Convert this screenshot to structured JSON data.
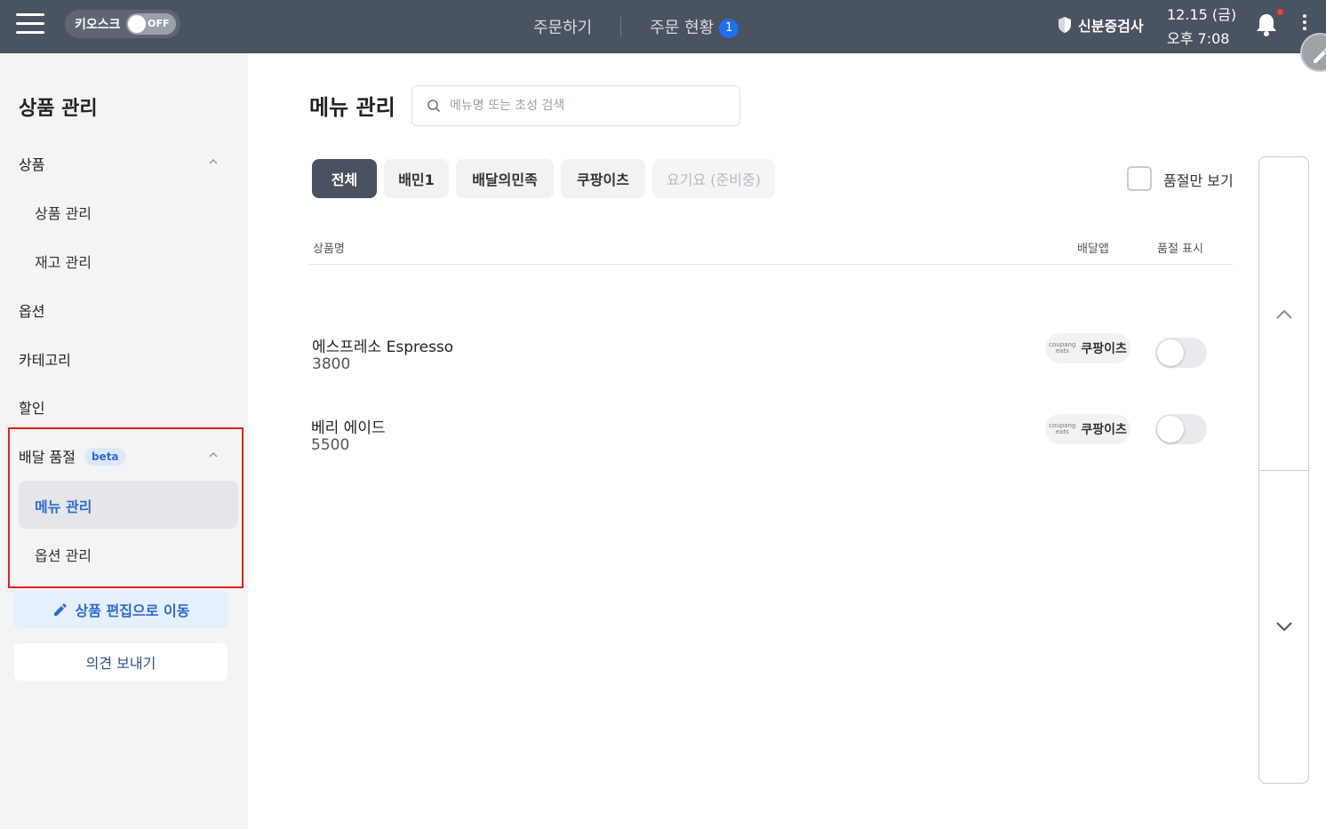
{
  "topbar": {
    "kiosk_label": "키오스크",
    "kiosk_toggle_state": "OFF",
    "nav": {
      "order": "주문하기",
      "status": "주문 현황",
      "status_badge": "1"
    },
    "id_check": "신분증검사",
    "date": "12.15 (금)",
    "time": "오후 7:08"
  },
  "sidebar": {
    "title": "상품 관리",
    "sections": {
      "product": "상품",
      "product_manage": "상품 관리",
      "stock_manage": "재고 관리",
      "option": "옵션",
      "category": "카테고리",
      "discount": "할인",
      "delivery_soldout": "배달 품절",
      "beta": "beta",
      "menu_manage": "메뉴 관리",
      "option_manage": "옵션 관리"
    },
    "edit_button": "상품 편집으로 이동",
    "feedback_button": "의견 보내기"
  },
  "main": {
    "title": "메뉴 관리",
    "search_placeholder": "메뉴명 또는 초성 검색",
    "filters": [
      "전체",
      "배민1",
      "배달의민족",
      "쿠팡이츠",
      "요기요 (준비중)"
    ],
    "active_filter": "전체",
    "soldout_only_label": "품절만 보기",
    "columns": {
      "name": "상품명",
      "app": "배달앱",
      "soldout": "품절 표시"
    },
    "rows": [
      {
        "name": "에스프레소 Espresso",
        "price": "3800",
        "app": "쿠팡이츠",
        "soldout": false
      },
      {
        "name": "베리 에이드",
        "price": "5500",
        "app": "쿠팡이츠",
        "soldout": false
      }
    ]
  },
  "icons": {
    "menu": "hamburger-icon",
    "shield": "shield-icon",
    "bell": "bell-icon",
    "more": "more-vertical-icon",
    "pencil": "pencil-icon",
    "search": "search-icon",
    "chevron_up": "chevron-up-icon",
    "chevron_down": "chevron-down-icon"
  },
  "colors": {
    "topbar": "#4a5360",
    "accent_blue": "#1e6ff1",
    "active_chip": "#49525e",
    "highlight_border": "#e32020"
  }
}
